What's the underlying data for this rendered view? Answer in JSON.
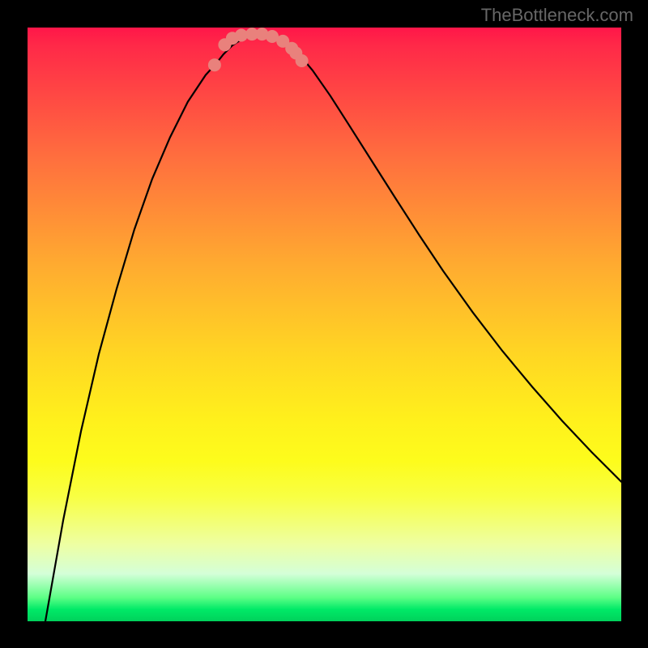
{
  "watermark": "TheBottleneck.com",
  "chart_data": {
    "type": "line",
    "title": "",
    "xlabel": "",
    "ylabel": "",
    "series": [
      {
        "name": "curve",
        "points": [
          [
            0.03,
            0.0
          ],
          [
            0.06,
            0.17
          ],
          [
            0.09,
            0.32
          ],
          [
            0.12,
            0.45
          ],
          [
            0.15,
            0.56
          ],
          [
            0.18,
            0.66
          ],
          [
            0.21,
            0.745
          ],
          [
            0.24,
            0.815
          ],
          [
            0.27,
            0.875
          ],
          [
            0.3,
            0.92
          ],
          [
            0.318,
            0.94
          ],
          [
            0.33,
            0.955
          ],
          [
            0.345,
            0.97
          ],
          [
            0.36,
            0.98
          ],
          [
            0.375,
            0.985
          ],
          [
            0.395,
            0.988
          ],
          [
            0.415,
            0.985
          ],
          [
            0.435,
            0.975
          ],
          [
            0.45,
            0.962
          ],
          [
            0.465,
            0.946
          ],
          [
            0.48,
            0.928
          ],
          [
            0.51,
            0.885
          ],
          [
            0.54,
            0.838
          ],
          [
            0.58,
            0.775
          ],
          [
            0.62,
            0.712
          ],
          [
            0.66,
            0.65
          ],
          [
            0.7,
            0.59
          ],
          [
            0.75,
            0.52
          ],
          [
            0.8,
            0.455
          ],
          [
            0.85,
            0.395
          ],
          [
            0.9,
            0.338
          ],
          [
            0.95,
            0.285
          ],
          [
            1.0,
            0.235
          ]
        ]
      }
    ],
    "markers": [
      [
        0.315,
        0.937
      ],
      [
        0.332,
        0.971
      ],
      [
        0.345,
        0.982
      ],
      [
        0.36,
        0.987
      ],
      [
        0.378,
        0.989
      ],
      [
        0.395,
        0.989
      ],
      [
        0.412,
        0.985
      ],
      [
        0.43,
        0.977
      ],
      [
        0.445,
        0.965
      ],
      [
        0.452,
        0.957
      ],
      [
        0.462,
        0.944
      ]
    ],
    "xlim": [
      0,
      1
    ],
    "ylim": [
      0,
      1
    ]
  }
}
